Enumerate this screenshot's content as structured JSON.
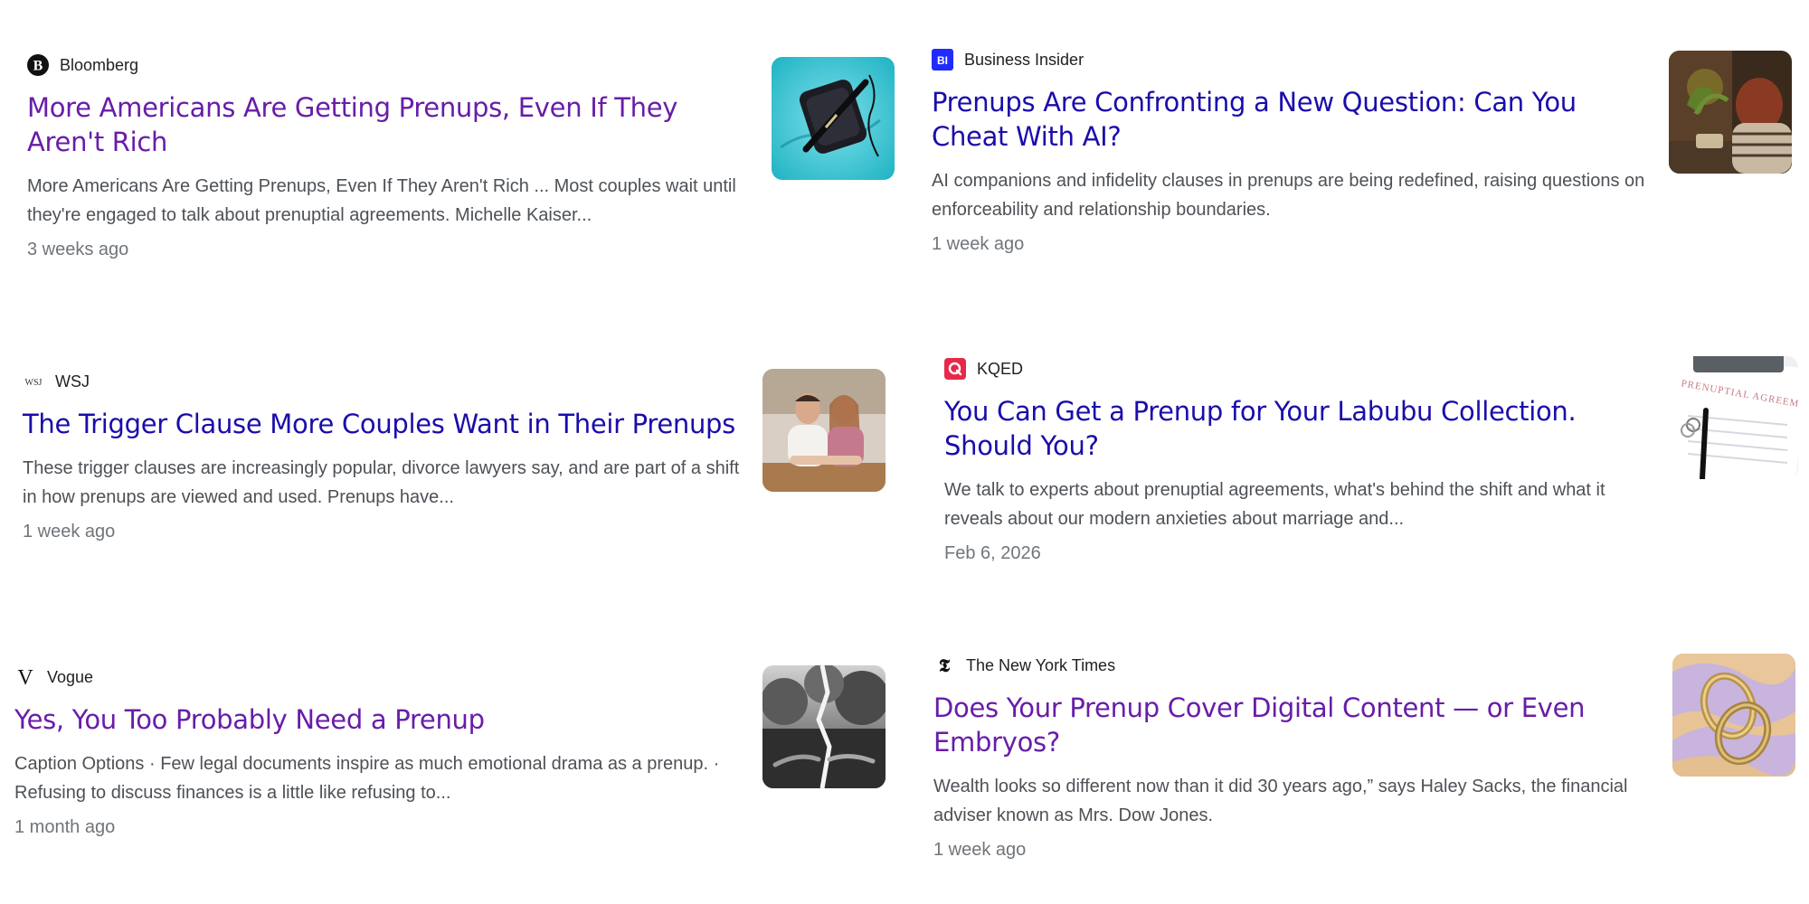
{
  "results": [
    {
      "source": "Bloomberg",
      "icon": "bloomberg-logo-icon",
      "headline": "More Americans Are Getting Prenups, Even If They Aren't Rich",
      "snippet": "More Americans Are Getting Prenups, Even If They Aren't Rich ... Most couples wait until they're engaged to talk about prenuptial agreements. Michelle Kaiser...",
      "age": "3 weeks ago",
      "visited": true,
      "thumb": "pen-on-teal-thumbnail"
    },
    {
      "source": "Business Insider",
      "icon": "business-insider-logo-icon",
      "icon_text": "BI",
      "headline": "Prenups Are Confronting a New Question: Can You Cheat With AI?",
      "snippet": "AI companions and infidelity clauses in prenups are being redefined, raising questions on enforceability and relationship boundaries.",
      "age": "1 week ago",
      "visited": false,
      "thumb": "woman-at-desk-thumbnail"
    },
    {
      "source": "WSJ",
      "icon": "wsj-logo-icon",
      "icon_text": "WSJ",
      "headline": "The Trigger Clause More Couples Want in Their Prenups",
      "snippet": "These trigger clauses are increasingly popular, divorce lawyers say, and are part of a shift in how prenups are viewed and used. Prenups have...",
      "age": "1 week ago",
      "visited": false,
      "thumb": "couple-portrait-thumbnail"
    },
    {
      "source": "KQED",
      "icon": "kqed-logo-icon",
      "headline": "You Can Get a Prenup for Your Labubu Collection. Should You?",
      "snippet": "We talk to experts about prenuptial agreements, what's behind the shift and what it reveals about our modern anxieties about marriage and...",
      "age": "Feb 6, 2026",
      "visited": false,
      "thumb": "prenuptial-document-thumbnail",
      "thumb_text": "PRENUPTIAL AGREEMENT"
    },
    {
      "source": "Vogue",
      "icon": "vogue-logo-icon",
      "icon_text": "V",
      "headline": "Yes, You Too Probably Need a Prenup",
      "snippet": "Caption Options · Few legal documents inspire as much emotional drama as a prenup. · Refusing to discuss finances is a little like refusing to...",
      "age": "1 month ago",
      "visited": true,
      "thumb": "hands-tree-bw-thumbnail"
    },
    {
      "source": "The New York Times",
      "icon": "nyt-logo-icon",
      "icon_text": "𝕿",
      "headline": "Does Your Prenup Cover Digital Content — or Even Embryos?",
      "snippet": "Wealth looks so different now than it did 30 years ago,” says Haley Sacks, the financial adviser known as Mrs. Dow Jones.",
      "age": "1 week ago",
      "visited": true,
      "thumb": "rings-thumbnail"
    }
  ],
  "colors": {
    "visited_link": "#681da8",
    "link": "#1a0dab",
    "snippet": "#4d5156",
    "age": "#70757a",
    "source": "#202124",
    "bi_blue": "#1f2bff",
    "kqed_red": "#e8284b"
  }
}
